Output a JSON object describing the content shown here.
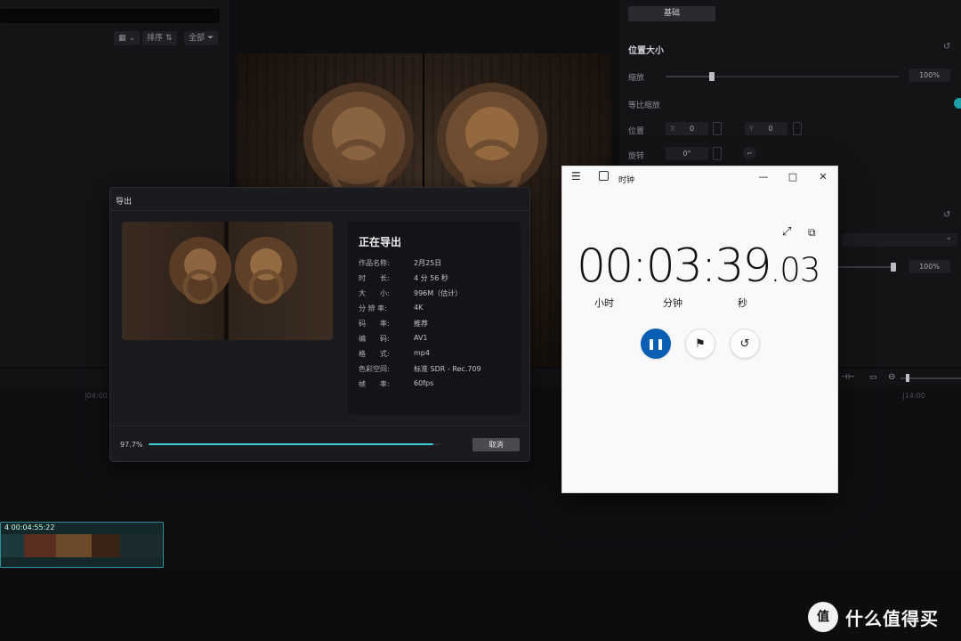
{
  "media_toolbar": {
    "view_icon": "grid-view-icon",
    "sort_label": "排序",
    "filter_label": "全部"
  },
  "inspector": {
    "tabs": [
      "基础",
      "",
      "",
      ""
    ],
    "section_title": "位置大小",
    "scale_label": "缩放",
    "scale_value": "100%",
    "uniform_scale_label": "等比缩放",
    "position_label": "位置",
    "pos_x_label": "X",
    "pos_x_value": "0",
    "pos_y_label": "Y",
    "pos_y_value": "0",
    "rotation_label": "旋转",
    "rotation_value": "0°",
    "second_value": "100%"
  },
  "timeline": {
    "ruler_left": "|04:00",
    "ruler_right": "|14:00",
    "clip_label": "4  00:04:55:22"
  },
  "export_dialog": {
    "title": "导出",
    "status": "正在导出",
    "rows": [
      {
        "key": "作品名称:",
        "value": "2月25日"
      },
      {
        "key": "时　　长:",
        "value": "4 分 56 秒"
      },
      {
        "key": "大　　小:",
        "value": "996M（估计）"
      },
      {
        "key": "分 辨 率:",
        "value": "4K"
      },
      {
        "key": "码　　率:",
        "value": "推荐"
      },
      {
        "key": "编　　码:",
        "value": "AV1"
      },
      {
        "key": "格　　式:",
        "value": "mp4"
      },
      {
        "key": "色彩空间:",
        "value": "标准 SDR - Rec.709"
      },
      {
        "key": "帧　　率:",
        "value": "60fps"
      }
    ],
    "progress_text": "97.7%",
    "progress": 0.977,
    "cancel_label": "取消"
  },
  "clock_window": {
    "title": "时钟",
    "time_main": "00:03:39",
    "time_fraction": ".03",
    "unit_hours": "小时",
    "unit_minutes": "分钟",
    "unit_seconds": "秒",
    "buttons": [
      "pause-icon",
      "flag-icon",
      "reset-icon"
    ]
  },
  "watermark": {
    "logo_text": "值",
    "text": "什么值得买"
  },
  "colors": {
    "accent_teal": "#3ccfd6",
    "clock_accent": "#0a5fb4"
  }
}
